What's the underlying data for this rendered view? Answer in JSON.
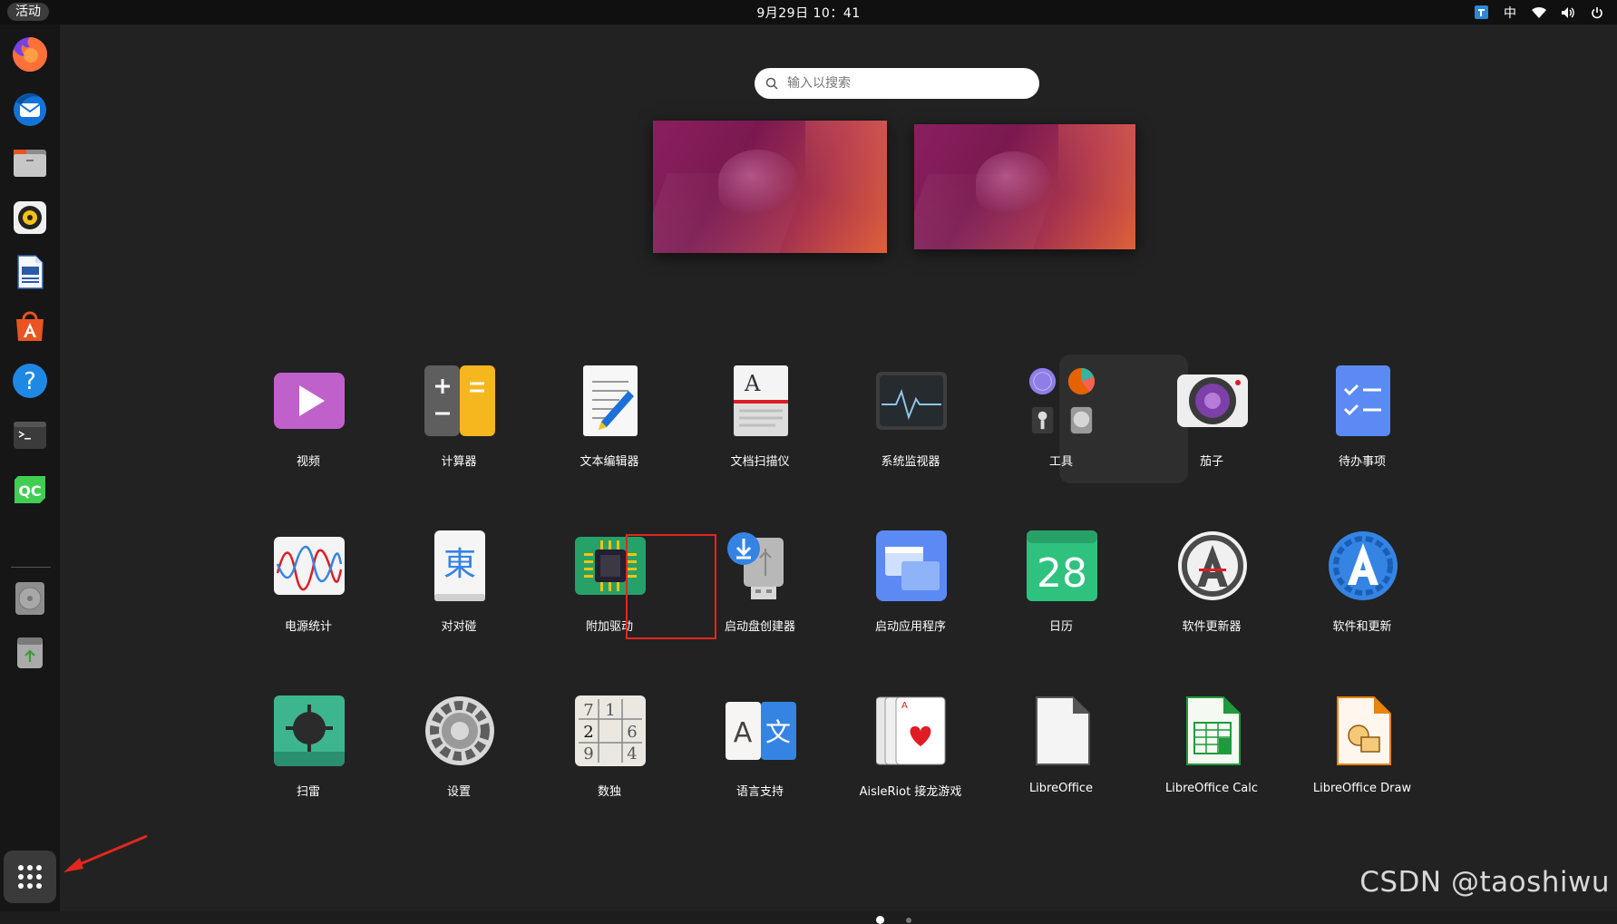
{
  "topbar": {
    "activities": "活动",
    "clock": "9月29日 10：41",
    "input_method": "中"
  },
  "search": {
    "placeholder": "输入以搜索"
  },
  "apps": [
    {
      "label": "视频",
      "icon": "video-icon"
    },
    {
      "label": "计算器",
      "icon": "calculator-icon"
    },
    {
      "label": "文本编辑器",
      "icon": "text-editor-icon"
    },
    {
      "label": "文档扫描仪",
      "icon": "document-scanner-icon"
    },
    {
      "label": "系统监视器",
      "icon": "system-monitor-icon"
    },
    {
      "label": "工具",
      "icon": "utilities-folder-icon"
    },
    {
      "label": "茄子",
      "icon": "cheese-camera-icon"
    },
    {
      "label": "待办事项",
      "icon": "todo-icon"
    },
    {
      "label": "电源统计",
      "icon": "power-statistics-icon"
    },
    {
      "label": "对对碰",
      "icon": "mahjong-icon"
    },
    {
      "label": "附加驱动",
      "icon": "additional-drivers-icon"
    },
    {
      "label": "启动盘创建器",
      "icon": "startup-disk-creator-icon"
    },
    {
      "label": "启动应用程序",
      "icon": "startup-applications-icon"
    },
    {
      "label": "日历",
      "icon": "calendar-icon"
    },
    {
      "label": "软件更新器",
      "icon": "software-updater-icon"
    },
    {
      "label": "软件和更新",
      "icon": "software-properties-icon"
    },
    {
      "label": "扫雷",
      "icon": "mines-icon"
    },
    {
      "label": "设置",
      "icon": "settings-gear-icon"
    },
    {
      "label": "数独",
      "icon": "sudoku-icon"
    },
    {
      "label": "语言支持",
      "icon": "language-support-icon"
    },
    {
      "label": "AisleRiot 接龙游戏",
      "icon": "aisleriot-cards-icon"
    },
    {
      "label": "LibreOffice",
      "icon": "libreoffice-icon"
    },
    {
      "label": "LibreOffice Calc",
      "icon": "libreoffice-calc-icon"
    },
    {
      "label": "LibreOffice Draw",
      "icon": "libreoffice-draw-icon"
    }
  ],
  "calendar_day": "28",
  "mahjong_char": "東",
  "sudoku_digits": [
    "7",
    "1",
    "2",
    "6",
    "9",
    "4"
  ],
  "lang_chars": [
    "A",
    "文"
  ],
  "watermark": "CSDN @taoshiwu",
  "dock": [
    "firefox-icon",
    "thunderbird-icon",
    "files-icon",
    "rhythmbox-icon",
    "writer-icon",
    "app-center-icon",
    "help-icon",
    "terminal-icon",
    "qtcreator-icon",
    "disc-icon",
    "trash-icon"
  ],
  "qtcreator_label": "QC",
  "pages": {
    "current": 1,
    "total": 2
  },
  "colors": {
    "highlight": "#e2271f",
    "panel": "#101010",
    "background": "#222222"
  }
}
